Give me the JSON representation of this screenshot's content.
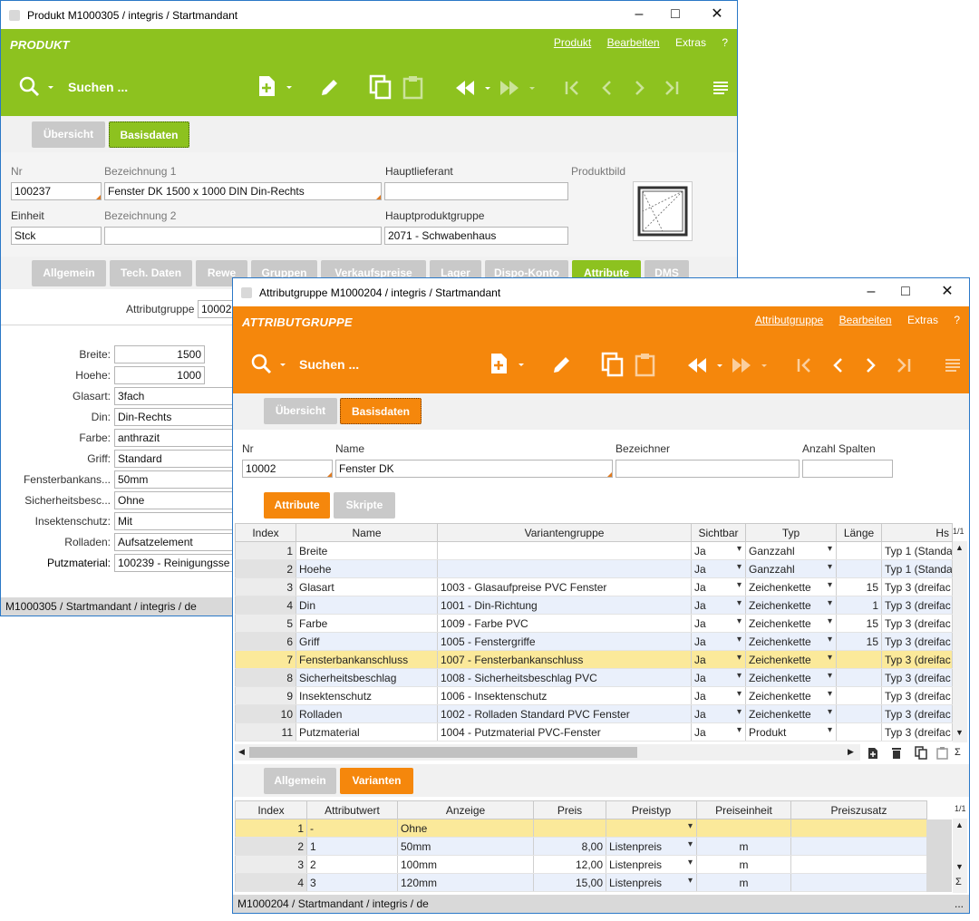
{
  "product_window": {
    "title": "Produkt M1000305 / integris / Startmandant",
    "module": "PRODUKT",
    "menu": [
      "Produkt",
      "Bearbeiten",
      "Extras",
      "?"
    ],
    "search_label": "Suchen ...",
    "accent": "#8dc21f",
    "main_tabs": [
      "Übersicht",
      "Basisdaten"
    ],
    "fields": {
      "nr_label": "Nr",
      "nr_value": "100237",
      "bez1_label": "Bezeichnung 1",
      "bez1_value": "Fenster DK  1500 x 1000  DIN Din-Rechts",
      "hauptlief_label": "Hauptlieferant",
      "hauptlief_value": "",
      "bild_label": "Produktbild",
      "einheit_label": "Einheit",
      "einheit_value": "Stck",
      "bez2_label": "Bezeichnung 2",
      "bez2_value": "",
      "hpg_label": "Hauptproduktgruppe",
      "hpg_value": "2071 - Schwabenhaus"
    },
    "sub_tabs": [
      "Allgemein",
      "Tech. Daten",
      "Rewe",
      "Gruppen",
      "Verkaufspreise",
      "Lager",
      "Dispo-Konto",
      "Attribute",
      "DMS"
    ],
    "attributgruppe_label": "Attributgruppe",
    "attributgruppe_value": "10002",
    "attributes": [
      {
        "label": "Breite:",
        "value": "1500"
      },
      {
        "label": "Hoehe:",
        "value": "1000"
      },
      {
        "label": "Glasart:",
        "value": "3fach"
      },
      {
        "label": "Din:",
        "value": "Din-Rechts"
      },
      {
        "label": "Farbe:",
        "value": "anthrazit"
      },
      {
        "label": "Griff:",
        "value": "Standard"
      },
      {
        "label": "Fensterbankans...",
        "value": "50mm"
      },
      {
        "label": "Sicherheitsbesc...",
        "value": "Ohne"
      },
      {
        "label": "Insektenschutz:",
        "value": "Mit"
      },
      {
        "label": "Rolladen:",
        "value": "Aufsatzelement"
      },
      {
        "label": "Putzmaterial:",
        "value": "100239 - Reinigungsse"
      }
    ],
    "status": "M1000305 / Startmandant / integris / de"
  },
  "attr_window": {
    "title": "Attributgruppe M1000204 / integris / Startmandant",
    "module": "ATTRIBUTGRUPPE",
    "menu": [
      "Attributgruppe",
      "Bearbeiten",
      "Extras",
      "?"
    ],
    "search_label": "Suchen ...",
    "accent": "#f5870c",
    "main_tabs": [
      "Übersicht",
      "Basisdaten"
    ],
    "fields": {
      "nr_label": "Nr",
      "nr_value": "10002",
      "name_label": "Name",
      "name_value": "Fenster DK",
      "bez_label": "Bezeichner",
      "bez_value": "",
      "spalten_label": "Anzahl Spalten",
      "spalten_value": ""
    },
    "inner_tabs": [
      "Attribute",
      "Skripte"
    ],
    "attr_table": {
      "headers": [
        "Index",
        "Name",
        "Variantengruppe",
        "Sichtbar",
        "Typ",
        "Länge",
        "Hs"
      ],
      "page": "1/1",
      "rows": [
        [
          "1",
          "Breite",
          "",
          "Ja",
          "Ganzzahl",
          "",
          "Typ 1 (Standa"
        ],
        [
          "2",
          "Hoehe",
          "",
          "Ja",
          "Ganzzahl",
          "",
          "Typ 1 (Standa"
        ],
        [
          "3",
          "Glasart",
          "1003 - Glasaufpreise PVC Fenster",
          "Ja",
          "Zeichenkette",
          "15",
          "Typ 3 (dreifac"
        ],
        [
          "4",
          "Din",
          "1001 - Din-Richtung",
          "Ja",
          "Zeichenkette",
          "1",
          "Typ 3 (dreifac"
        ],
        [
          "5",
          "Farbe",
          "1009 - Farbe PVC",
          "Ja",
          "Zeichenkette",
          "15",
          "Typ 3 (dreifac"
        ],
        [
          "6",
          "Griff",
          "1005 - Fenstergriffe",
          "Ja",
          "Zeichenkette",
          "15",
          "Typ 3 (dreifac"
        ],
        [
          "7",
          "Fensterbankanschluss",
          "1007 - Fensterbankanschluss",
          "Ja",
          "Zeichenkette",
          "",
          "Typ 3 (dreifac"
        ],
        [
          "8",
          "Sicherheitsbeschlag",
          "1008 - Sicherheitsbeschlag PVC",
          "Ja",
          "Zeichenkette",
          "",
          "Typ 3 (dreifac"
        ],
        [
          "9",
          "Insektenschutz",
          "1006 - Insektenschutz",
          "Ja",
          "Zeichenkette",
          "",
          "Typ 3 (dreifac"
        ],
        [
          "10",
          "Rolladen",
          "1002 - Rolladen Standard PVC Fenster",
          "Ja",
          "Zeichenkette",
          "",
          "Typ 3 (dreifac"
        ],
        [
          "11",
          "Putzmaterial",
          "1004 - Putzmaterial PVC-Fenster",
          "Ja",
          "Produkt",
          "",
          "Typ 3 (dreifac"
        ]
      ],
      "selected_row": 7
    },
    "lower_tabs": [
      "Allgemein",
      "Varianten"
    ],
    "var_table": {
      "headers": [
        "Index",
        "Attributwert",
        "Anzeige",
        "Preis",
        "Preistyp",
        "Preiseinheit",
        "Preiszusatz"
      ],
      "page": "1/1",
      "rows": [
        [
          "1",
          "-",
          "Ohne",
          "",
          "",
          "",
          ""
        ],
        [
          "2",
          "1",
          "50mm",
          "8,00",
          "Listenpreis",
          "m",
          ""
        ],
        [
          "3",
          "2",
          "100mm",
          "12,00",
          "Listenpreis",
          "m",
          ""
        ],
        [
          "4",
          "3",
          "120mm",
          "15,00",
          "Listenpreis",
          "m",
          ""
        ]
      ],
      "selected_row": 1
    },
    "status": "M1000204 / Startmandant / integris / de",
    "status_more": "..."
  }
}
